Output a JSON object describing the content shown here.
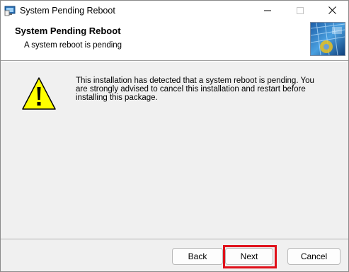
{
  "window": {
    "title": "System Pending Reboot",
    "icons": {
      "app": "installer-icon",
      "minimize": "minimize-icon",
      "maximize": "maximize-icon",
      "close": "close-icon"
    }
  },
  "header": {
    "title": "System Pending Reboot",
    "subtitle": "A system reboot is pending",
    "banner_icon": "installer-banner-icon"
  },
  "body": {
    "icon": "warning-icon",
    "message": "This installation has detected that a system reboot is pending.  You are strongly advised to cancel this installation and restart before installing this package."
  },
  "buttons": {
    "back_label": "Back",
    "next_label": "Next",
    "cancel_label": "Cancel"
  },
  "highlight": {
    "target": "next-button",
    "color": "#e0101a"
  }
}
